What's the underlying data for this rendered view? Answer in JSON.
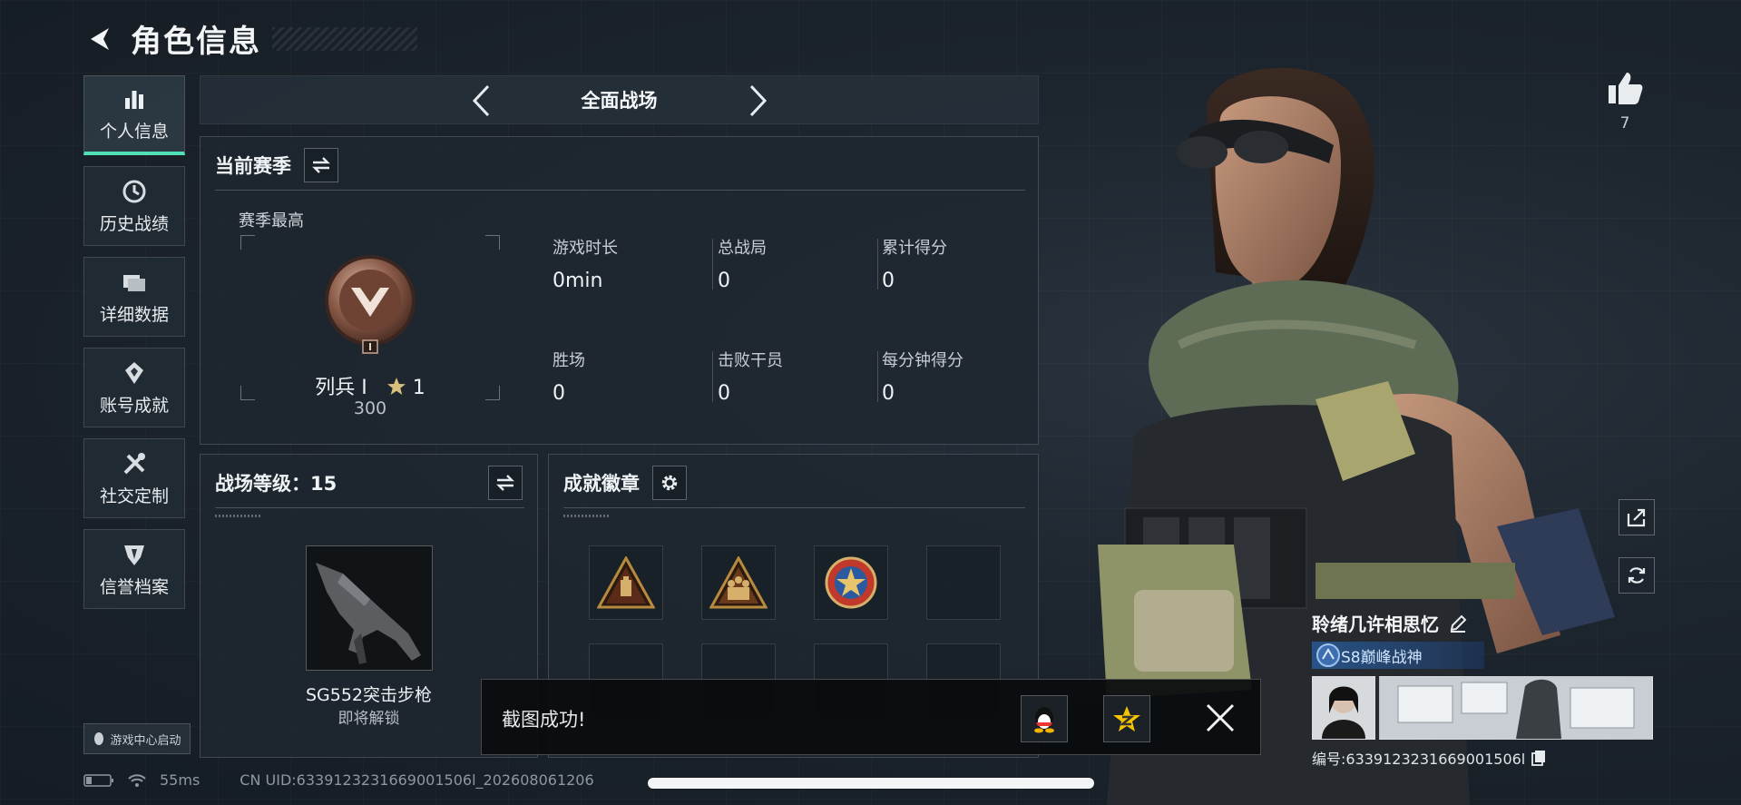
{
  "header": {
    "title": "角色信息"
  },
  "nav": {
    "items": [
      {
        "label": "个人信息",
        "icon": "bar-chart-icon",
        "active": true
      },
      {
        "label": "历史战绩",
        "icon": "clock-icon",
        "active": false
      },
      {
        "label": "详细数据",
        "icon": "folder-icon",
        "active": false
      },
      {
        "label": "账号成就",
        "icon": "achievement-icon",
        "active": false
      },
      {
        "label": "社交定制",
        "icon": "tools-icon",
        "active": false
      },
      {
        "label": "信誉档案",
        "icon": "shield-icon",
        "active": false
      }
    ],
    "launch_label": "游戏中心启动"
  },
  "mode": {
    "title": "全面战场"
  },
  "season": {
    "title": "当前赛季",
    "best_label": "赛季最高",
    "rank_name": "列兵 I",
    "rank_stars": "1",
    "rank_points": "300",
    "stats": [
      {
        "label": "游戏时长",
        "value": "0min"
      },
      {
        "label": "总战局",
        "value": "0"
      },
      {
        "label": "累计得分",
        "value": "0"
      },
      {
        "label": "胜场",
        "value": "0"
      },
      {
        "label": "击败干员",
        "value": "0"
      },
      {
        "label": "每分钟得分",
        "value": "0"
      }
    ]
  },
  "battlefield": {
    "level_label": "战场等级：15",
    "weapon_name": "SG552突击步枪",
    "weapon_status": "即将解锁"
  },
  "badges": {
    "title": "成就徽章",
    "slots": [
      "triangle-badge",
      "soldiers-badge",
      "star-emblem-badge",
      "empty",
      "empty",
      "empty",
      "empty",
      "empty"
    ]
  },
  "toast": {
    "text": "截图成功!"
  },
  "status_bar": {
    "ping": "55ms",
    "uid": "CN UID:6339123231669001506l_202608061206"
  },
  "player": {
    "likes": "7",
    "name": "聆绪几许相思忆",
    "title": "S8巅峰战神",
    "id": "编号:6339123231669001506l"
  },
  "colors": {
    "accent": "#52e0b6",
    "background": "#1a222b"
  }
}
